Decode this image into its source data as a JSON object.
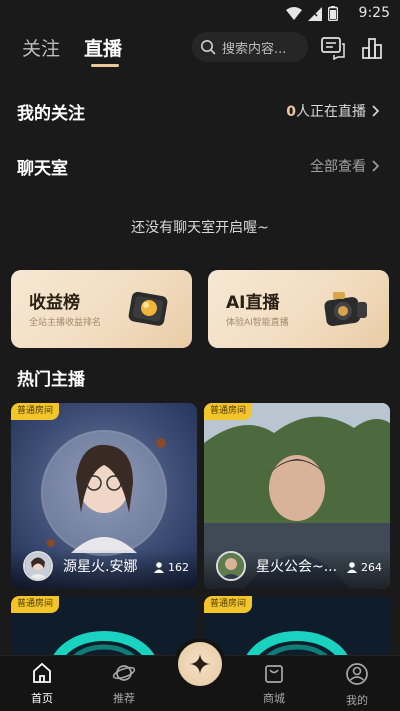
{
  "status": {
    "time": "9:25"
  },
  "header": {
    "tabs": [
      {
        "label": "关注"
      },
      {
        "label": "直播"
      }
    ],
    "search_placeholder": "搜索内容..."
  },
  "my_follow": {
    "title": "我的关注",
    "count": "0",
    "live_text": "人正在直播"
  },
  "chat_room": {
    "title": "聊天室",
    "view_all": "全部查看",
    "empty": "还没有聊天室开启喔~"
  },
  "features": [
    {
      "title": "收益榜",
      "subtitle": "全站主播收益排名"
    },
    {
      "title": "AI直播",
      "subtitle": "体验AI智能直播"
    }
  ],
  "hot": {
    "title": "热门主播",
    "cards": [
      {
        "badge": "普通房间",
        "name": "源星火.安娜",
        "viewers": "162"
      },
      {
        "badge": "普通房间",
        "name": "星火公会~...",
        "viewers": "264"
      },
      {
        "badge": "普通房间"
      },
      {
        "badge": "普通房间"
      }
    ]
  },
  "nav": [
    {
      "label": "首页",
      "icon": "home-icon"
    },
    {
      "label": "推荐",
      "icon": "planet-icon"
    },
    {
      "label": "商城",
      "icon": "shop-bag-icon"
    },
    {
      "label": "我的",
      "icon": "profile-icon"
    }
  ],
  "colors": {
    "accent": "#e9c99a",
    "badge": "#f4c52b",
    "background": "#1a1a1a"
  }
}
